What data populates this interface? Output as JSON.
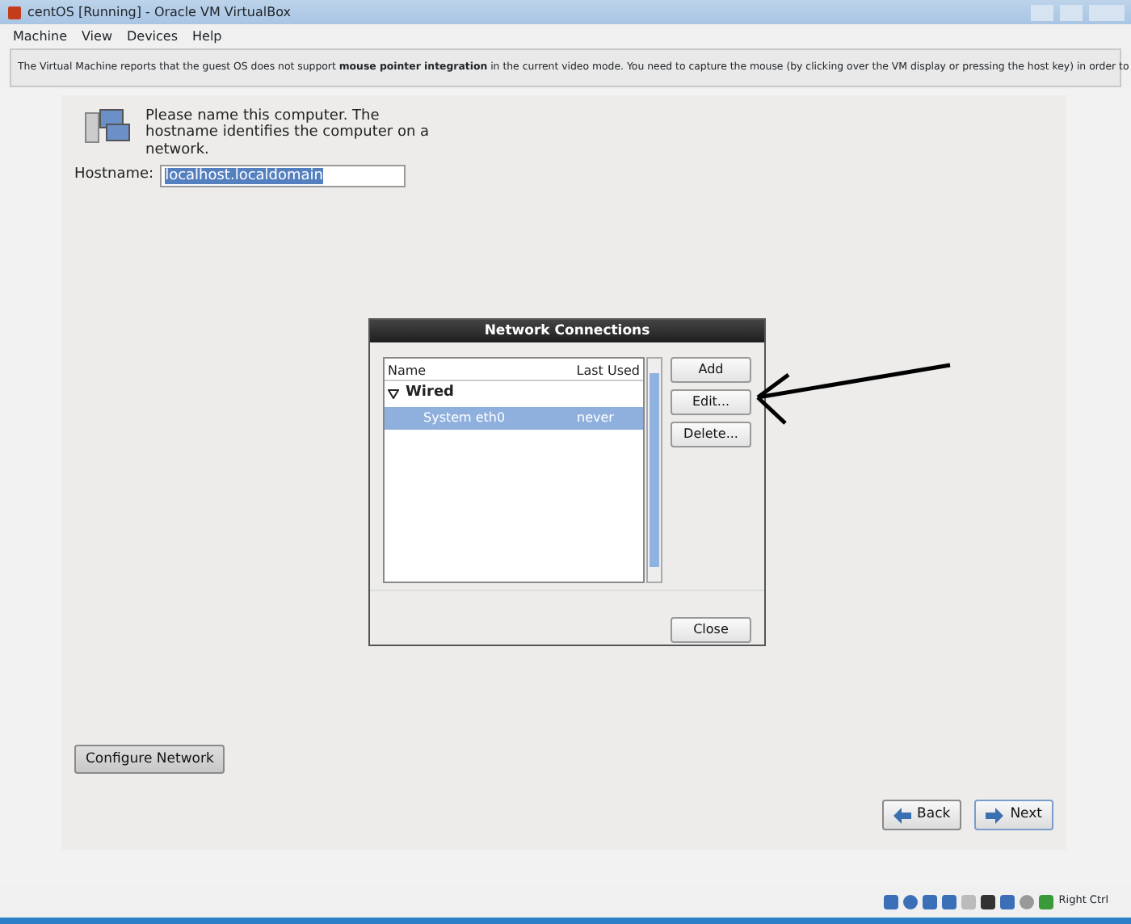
{
  "window": {
    "title": "centOS [Running] - Oracle VM VirtualBox"
  },
  "menu": [
    "Machine",
    "View",
    "Devices",
    "Help"
  ],
  "notice": {
    "text": "The Virtual Machine reports that the guest OS does not support **mouse pointer integration** in the current video mode. You need to capture the mouse (by clicking over the VM display or pressing the host key) in order to"
  },
  "installer": {
    "prompt": "Please name this computer.  The hostname identifies the computer on a network.",
    "hostname_label": "Hostname:",
    "hostname_value": "localhost.localdomain",
    "configure_button": "Configure Network",
    "back_button": "Back",
    "next_button": "Next"
  },
  "dialog": {
    "title": "Network Connections",
    "columns": [
      "Name",
      "Last Used"
    ],
    "groups": [
      {
        "label": "Wired",
        "expanded": true,
        "children": [
          {
            "name": "System eth0",
            "last_used": "never",
            "selected": true
          }
        ]
      }
    ],
    "buttons": [
      "Add",
      "Edit...",
      "Delete..."
    ],
    "close_button": "Close"
  },
  "status_bar": {
    "host_key": "Right Ctrl"
  }
}
